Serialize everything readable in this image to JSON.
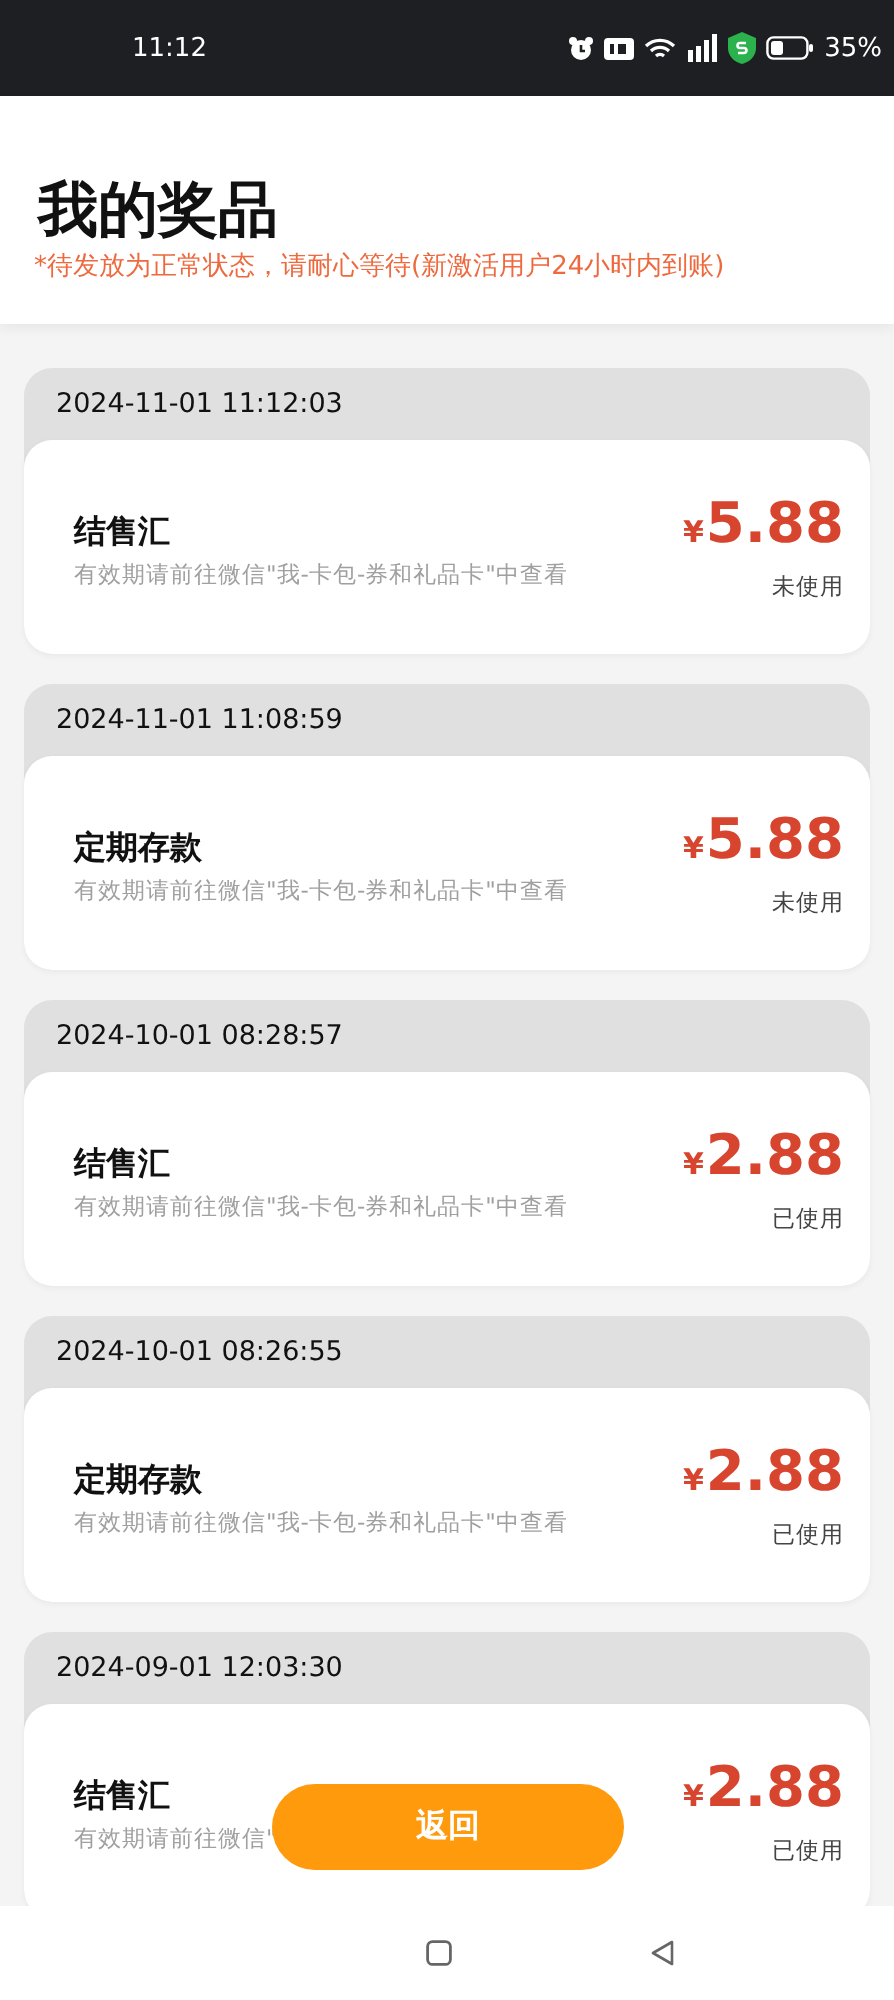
{
  "status_bar": {
    "time": "11:12",
    "battery": "35%"
  },
  "header": {
    "title": "我的奖品",
    "notice": "*待发放为正常状态，请耐心等待(新激活用户24小时内到账)"
  },
  "prizes": [
    {
      "time": "2024-11-01 11:12:03",
      "name": "结售汇",
      "description": "有效期请前往微信\"我-卡包-券和礼品卡\"中查看",
      "currency": "¥",
      "amount": "5.88",
      "status": "未使用"
    },
    {
      "time": "2024-11-01 11:08:59",
      "name": "定期存款",
      "description": "有效期请前往微信\"我-卡包-券和礼品卡\"中查看",
      "currency": "¥",
      "amount": "5.88",
      "status": "未使用"
    },
    {
      "time": "2024-10-01 08:28:57",
      "name": "结售汇",
      "description": "有效期请前往微信\"我-卡包-券和礼品卡\"中查看",
      "currency": "¥",
      "amount": "2.88",
      "status": "已使用"
    },
    {
      "time": "2024-10-01 08:26:55",
      "name": "定期存款",
      "description": "有效期请前往微信\"我-卡包-券和礼品卡\"中查看",
      "currency": "¥",
      "amount": "2.88",
      "status": "已使用"
    },
    {
      "time": "2024-09-01 12:03:30",
      "name": "结售汇",
      "description": "有效期请前往微信\"",
      "currency": "¥",
      "amount": "2.88",
      "status": "已使用"
    }
  ],
  "back_button": {
    "label": "返回"
  }
}
